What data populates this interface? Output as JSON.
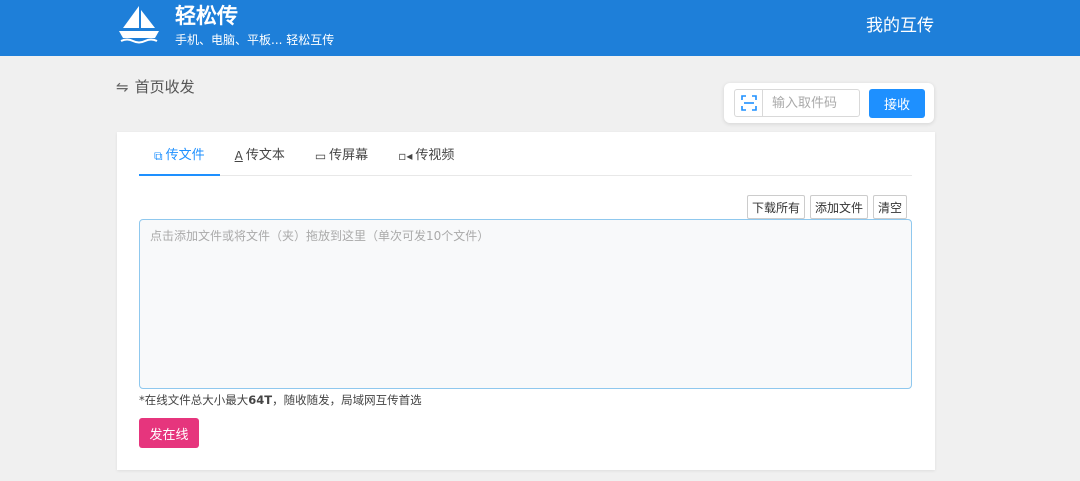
{
  "header": {
    "brand": "轻松传",
    "tagline": "手机、电脑、平板... 轻松互传",
    "my_transfers": "我的互传",
    "logo_icon": "sailboat-icon",
    "bg_color": "#1e7fd9"
  },
  "breadcrumb": {
    "icon": "swap-icon",
    "label": "首页收发"
  },
  "receive": {
    "scan_icon": "scan-icon",
    "placeholder": "输入取件码",
    "button": "接收"
  },
  "tabs": [
    {
      "icon": "file-icon",
      "label": "传文件",
      "active": true
    },
    {
      "icon": "text-icon",
      "label": "传文本",
      "active": false
    },
    {
      "icon": "screen-icon",
      "label": "传屏幕",
      "active": false
    },
    {
      "icon": "video-icon",
      "label": "传视频",
      "active": false
    }
  ],
  "file_actions": {
    "download_all": "下载所有",
    "add_files": "添加文件",
    "clear": "清空"
  },
  "dropzone": {
    "hint": "点击添加文件或将文件（夹）拖放到这里（单次可发10个文件）"
  },
  "note": {
    "prefix": "*在线文件总大小最大",
    "size": "64T",
    "suffix": "，随收随发，局域网互传首选"
  },
  "send": {
    "button": "发在线",
    "color": "#e6357d"
  },
  "accent_color": "#1e90ff"
}
